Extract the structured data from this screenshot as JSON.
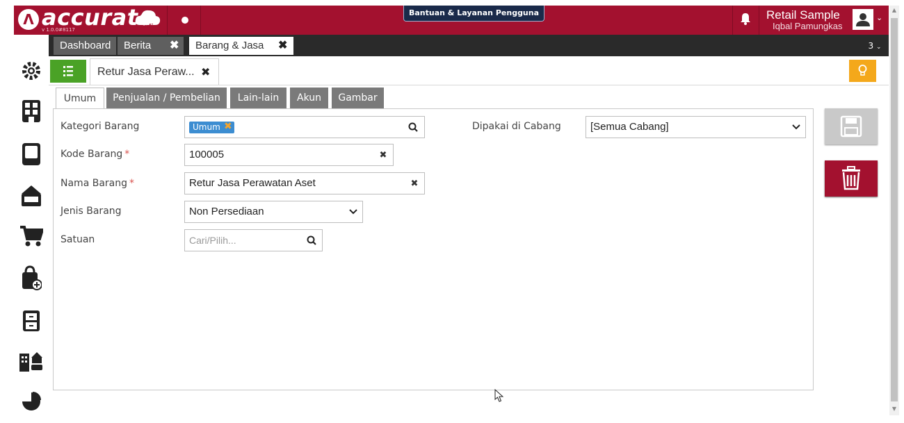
{
  "header": {
    "logo_text": "accurate",
    "logo_sub": "online",
    "version": "v 1.0.0#8117",
    "help_button": "Bantuan & Layanan Pengguna",
    "company": "Retail Sample",
    "user": "Iqbal Pamungkas"
  },
  "main_tabs": [
    {
      "label": "Dashboard"
    },
    {
      "label": "Berita",
      "close": "✖"
    },
    {
      "label": "Barang & Jasa",
      "close": "✖"
    }
  ],
  "tab_count": "3",
  "tab_count_caret": "⌄",
  "doc_tab": {
    "label": "Retur Jasa Peraw...",
    "close": "✖"
  },
  "form_tabs": [
    "Umum",
    "Penjualan / Pembelian",
    "Lain-lain",
    "Akun",
    "Gambar"
  ],
  "form": {
    "kategori": {
      "label": "Kategori Barang",
      "chip": "Umum"
    },
    "kode": {
      "label": "Kode Barang",
      "required": "*",
      "value": "100005"
    },
    "nama": {
      "label": "Nama Barang",
      "required": "*",
      "value": "Retur Jasa Perawatan Aset"
    },
    "jenis": {
      "label": "Jenis Barang",
      "value": "Non Persediaan"
    },
    "satuan": {
      "label": "Satuan",
      "placeholder": "Cari/Pilih..."
    },
    "cabang": {
      "label": "Dipakai di Cabang",
      "value": "[Semua Cabang]"
    }
  },
  "sidebar_icons": [
    "gear-icon",
    "grid-icon",
    "ledger-icon",
    "wallet-icon",
    "cart-icon",
    "bag-plus-icon",
    "cabinet-icon",
    "building-icon",
    "pie-chart-icon"
  ],
  "colors": {
    "brand": "#a3112f",
    "chip": "#3c8dd1",
    "list_button": "#4aa226",
    "bulb": "#f4a81b"
  }
}
